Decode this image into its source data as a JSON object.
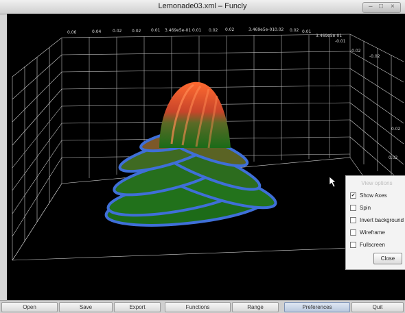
{
  "window": {
    "title": "Lemonade03.xml – Funcly"
  },
  "axes": {
    "top_ticks": [
      "0.06",
      "0.04",
      "0.02",
      "0.02",
      "0.01",
      "3.469e5e-01",
      "0.01",
      "0.02",
      "0.02",
      "3.469e5e-01",
      "0.02",
      "0.02",
      "0.01"
    ],
    "right_ticks": [
      "3.469e5e-01",
      "-0.01",
      "-0.02",
      "-0.02",
      "0.02",
      "0.02"
    ]
  },
  "view_options": {
    "title": "View options",
    "items": [
      {
        "label": "Show Axes",
        "checked": "✔"
      },
      {
        "label": "Spin",
        "checked": ""
      },
      {
        "label": "Invert background",
        "checked": ""
      },
      {
        "label": "Wireframe",
        "checked": ""
      },
      {
        "label": "Fullscreen",
        "checked": ""
      }
    ],
    "close_label": "Close"
  },
  "toolbar": {
    "buttons": [
      {
        "label": "Open"
      },
      {
        "label": "Save"
      },
      {
        "label": "Export"
      },
      {
        "label": "Functions"
      },
      {
        "label": "Range"
      },
      {
        "label": "Preferences"
      },
      {
        "label": "Quit"
      }
    ]
  },
  "colors": {
    "surface_top": "#f05a2a",
    "surface_bottom": "#1f7a1c",
    "rim": "#3f6fd8",
    "grid": "#cfcfcf"
  }
}
